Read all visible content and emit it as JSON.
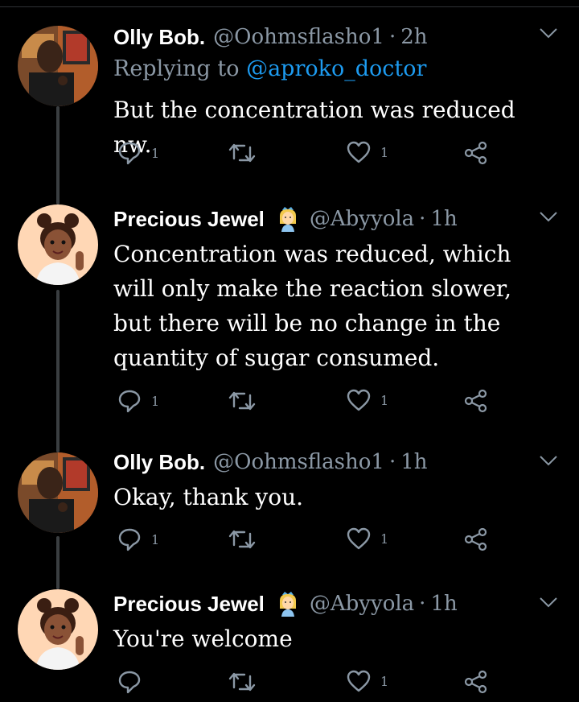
{
  "tweets": [
    {
      "name": "Olly Bob.",
      "handle": "@Oohmsflasho1",
      "time": "2h",
      "reply_prefix": "Replying to ",
      "reply_mention": "@aproko_doctor",
      "text": "But the concentration was reduced nw.",
      "replies": "1",
      "likes": "1"
    },
    {
      "name": "Precious Jewel",
      "handle": "@Abyyola",
      "time": "1h",
      "emoji": "princess",
      "text": "Concentration was reduced, which will only make the reaction slower, but there will be  no change in the quantity of sugar consumed.",
      "replies": "1",
      "likes": "1"
    },
    {
      "name": "Olly Bob.",
      "handle": "@Oohmsflasho1",
      "time": "1h",
      "text": "Okay, thank you.",
      "replies": "1",
      "likes": "1"
    },
    {
      "name": "Precious Jewel",
      "handle": "@Abyyola",
      "time": "1h",
      "emoji": "princess",
      "text": "You're welcome",
      "likes": "1"
    }
  ],
  "separator": "·",
  "colors": {
    "background": "#000000",
    "muted": "#8b98a5",
    "link": "#1d9bf0",
    "thread_line": "#3a3e41"
  }
}
